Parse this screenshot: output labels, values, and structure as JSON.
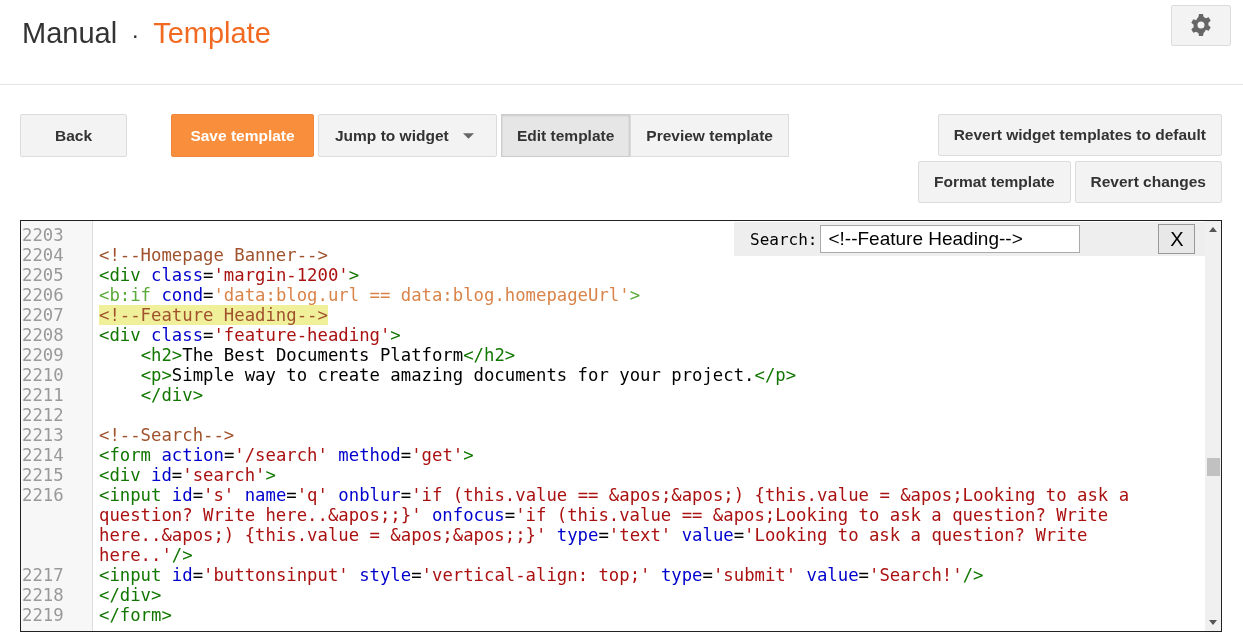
{
  "header": {
    "title": "Manual",
    "separator": "·",
    "section": "Template"
  },
  "toolbar": {
    "back": "Back",
    "save": "Save template",
    "jump": "Jump to widget",
    "mode_tabs": [
      {
        "label": "Edit template",
        "selected": true
      },
      {
        "label": "Preview template",
        "selected": false
      }
    ],
    "right_buttons": [
      [
        "Revert widget templates to default"
      ],
      [
        "Format template",
        "Revert changes"
      ]
    ]
  },
  "search": {
    "label": "Search:",
    "value": "<!--Feature Heading-->",
    "close": "X"
  },
  "code_lines": [
    {
      "number": "2203",
      "highlighted": false
    },
    {
      "number": "2204",
      "highlighted": false,
      "tokens": [
        {
          "kind": "comment",
          "text": "<!--Homepage Banner-->"
        }
      ]
    },
    {
      "number": "2205",
      "highlighted": false,
      "tokens": [
        {
          "kind": "tag",
          "text": "<div"
        },
        {
          "kind": "attr",
          "text": " class"
        },
        {
          "kind": "plain",
          "text": "="
        },
        {
          "kind": "string",
          "text": "'margin-1200'"
        },
        {
          "kind": "tag",
          "text": ">"
        }
      ]
    },
    {
      "number": "2206",
      "highlighted": false,
      "tokens": [
        {
          "kind": "tag-light",
          "text": "<b:if"
        },
        {
          "kind": "attr",
          "text": " cond"
        },
        {
          "kind": "plain",
          "text": "="
        },
        {
          "kind": "string-light",
          "text": "'data:blog.url == data:blog.homepageUrl'"
        },
        {
          "kind": "tag-light",
          "text": ">"
        }
      ]
    },
    {
      "number": "2207",
      "highlighted": true,
      "tokens": [
        {
          "kind": "comment",
          "text": "<!--Feature Heading-->"
        }
      ]
    },
    {
      "number": "2208",
      "highlighted": false,
      "tokens": [
        {
          "kind": "tag",
          "text": "<div"
        },
        {
          "kind": "attr",
          "text": " class"
        },
        {
          "kind": "plain",
          "text": "="
        },
        {
          "kind": "string",
          "text": "'feature-heading'"
        },
        {
          "kind": "tag",
          "text": ">"
        }
      ]
    },
    {
      "number": "2209",
      "highlighted": false,
      "tokens": [
        {
          "kind": "tag",
          "text": "    <h2>"
        },
        {
          "kind": "plain",
          "text": "The Best Documents Platform"
        },
        {
          "kind": "tag",
          "text": "</h2>"
        }
      ]
    },
    {
      "number": "2210",
      "highlighted": false,
      "tokens": [
        {
          "kind": "tag",
          "text": "    <p>"
        },
        {
          "kind": "plain",
          "text": "Simple way to create amazing documents for your project."
        },
        {
          "kind": "tag",
          "text": "</p>"
        }
      ]
    },
    {
      "number": "2211",
      "highlighted": false,
      "tokens": [
        {
          "kind": "tag",
          "text": "    </div>"
        }
      ]
    },
    {
      "number": "2212",
      "highlighted": false
    },
    {
      "number": "2213",
      "highlighted": false,
      "tokens": [
        {
          "kind": "comment",
          "text": "<!--Search-->"
        }
      ]
    },
    {
      "number": "2214",
      "highlighted": false,
      "tokens": [
        {
          "kind": "tag",
          "text": "<form"
        },
        {
          "kind": "attr",
          "text": " action"
        },
        {
          "kind": "plain",
          "text": "="
        },
        {
          "kind": "string",
          "text": "'/search'"
        },
        {
          "kind": "attr",
          "text": " method"
        },
        {
          "kind": "plain",
          "text": "="
        },
        {
          "kind": "string",
          "text": "'get'"
        },
        {
          "kind": "tag",
          "text": ">"
        }
      ]
    },
    {
      "number": "2215",
      "highlighted": false,
      "tokens": [
        {
          "kind": "tag",
          "text": "<div"
        },
        {
          "kind": "attr",
          "text": " id"
        },
        {
          "kind": "plain",
          "text": "="
        },
        {
          "kind": "string",
          "text": "'search'"
        },
        {
          "kind": "tag",
          "text": ">"
        }
      ]
    },
    {
      "number": "2216",
      "highlighted": false,
      "tokens": [
        {
          "kind": "tag",
          "text": "<input"
        },
        {
          "kind": "attr",
          "text": " id"
        },
        {
          "kind": "plain",
          "text": "="
        },
        {
          "kind": "string",
          "text": "'s'"
        },
        {
          "kind": "attr",
          "text": " name"
        },
        {
          "kind": "plain",
          "text": "="
        },
        {
          "kind": "string",
          "text": "'q'"
        },
        {
          "kind": "attr",
          "text": " onblur"
        },
        {
          "kind": "plain",
          "text": "="
        },
        {
          "kind": "string",
          "text": "'if (this.value == &apos;&apos;) {this.value = &apos;Looking to ask a question? Write here..&apos;;}'"
        },
        {
          "kind": "attr",
          "text": " onfocus"
        },
        {
          "kind": "plain",
          "text": "="
        },
        {
          "kind": "string",
          "text": "'if (this.value == &apos;Looking to ask a question? Write here..&apos;) {this.value = &apos;&apos;;}'"
        },
        {
          "kind": "attr",
          "text": " type"
        },
        {
          "kind": "plain",
          "text": "="
        },
        {
          "kind": "string",
          "text": "'text'"
        },
        {
          "kind": "attr",
          "text": " value"
        },
        {
          "kind": "plain",
          "text": "="
        },
        {
          "kind": "string",
          "text": "'Looking to ask a question? Write here..'"
        },
        {
          "kind": "tag",
          "text": "/>"
        }
      ]
    },
    {
      "number": "2217",
      "highlighted": false,
      "tokens": [
        {
          "kind": "tag",
          "text": "<input"
        },
        {
          "kind": "attr",
          "text": " id"
        },
        {
          "kind": "plain",
          "text": "="
        },
        {
          "kind": "string",
          "text": "'buttonsinput'"
        },
        {
          "kind": "attr",
          "text": " style"
        },
        {
          "kind": "plain",
          "text": "="
        },
        {
          "kind": "string",
          "text": "'vertical-align: top;'"
        },
        {
          "kind": "attr",
          "text": " type"
        },
        {
          "kind": "plain",
          "text": "="
        },
        {
          "kind": "string",
          "text": "'submit'"
        },
        {
          "kind": "attr",
          "text": " value"
        },
        {
          "kind": "plain",
          "text": "="
        },
        {
          "kind": "string",
          "text": "'Search!'"
        },
        {
          "kind": "tag",
          "text": "/>"
        }
      ]
    },
    {
      "number": "2218",
      "highlighted": false,
      "tokens": [
        {
          "kind": "tag",
          "text": "</div>"
        }
      ]
    },
    {
      "number": "2219",
      "highlighted": false,
      "tokens": [
        {
          "kind": "tag",
          "text": "</form>"
        }
      ]
    }
  ]
}
